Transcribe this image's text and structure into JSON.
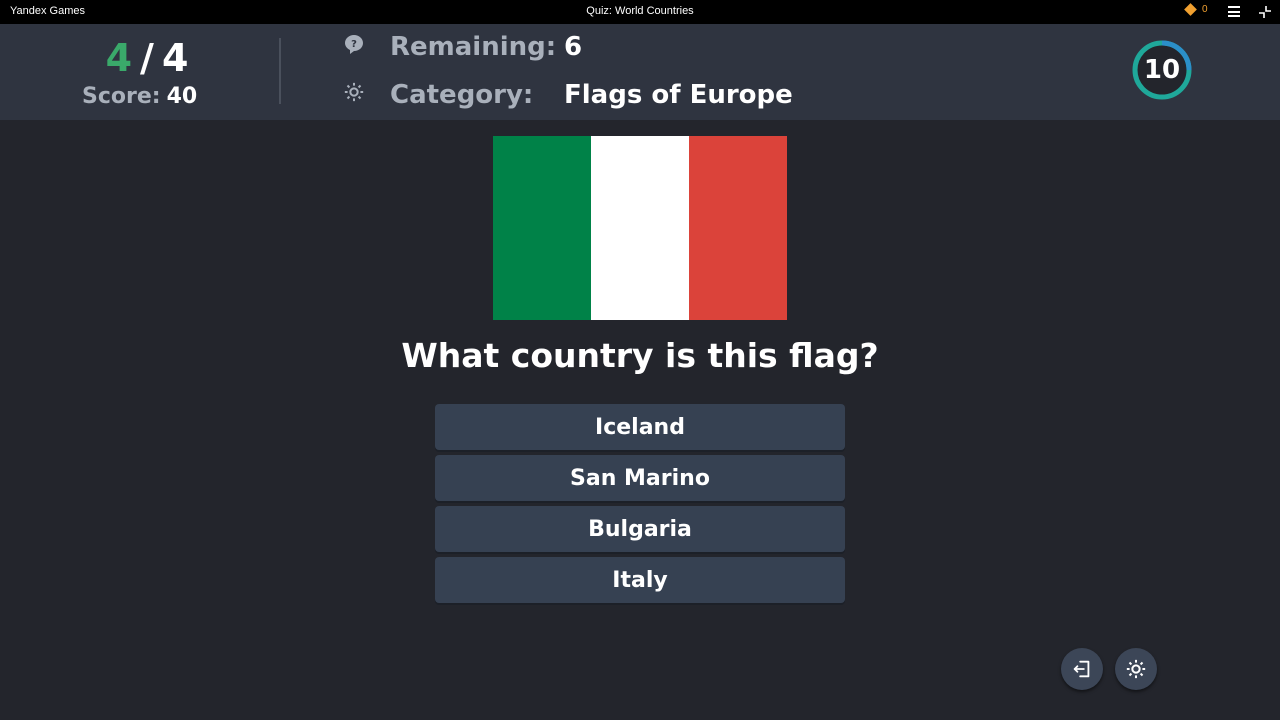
{
  "topbar": {
    "app_title": "Yandex Games",
    "game_title": "Quiz: World Countries",
    "coins": "0",
    "coin_color": "#f0a030"
  },
  "header": {
    "answered": "4",
    "separator": "/",
    "total": "4",
    "score_label": "Score:",
    "score_value": "40",
    "remaining_label": "Remaining:",
    "remaining_value": "6",
    "category_label": "Category:",
    "category_value": "Flags of Europe",
    "timer": "10",
    "remaining_icon": "question-bubble-icon",
    "category_icon": "gear-icon"
  },
  "flag": {
    "colors": [
      "#008248",
      "#ffffff",
      "#db433a"
    ]
  },
  "question": "What country is this flag?",
  "answers": [
    {
      "label": "Iceland"
    },
    {
      "label": "San Marino"
    },
    {
      "label": "Bulgaria"
    },
    {
      "label": "Italy"
    }
  ],
  "buttons": {
    "exit_icon": "exit-icon",
    "settings_icon": "gear-icon"
  },
  "colors": {
    "background": "#23252c",
    "header": "#2f3440",
    "answer_button": "#364152",
    "accent_green": "#3aa96a",
    "timer_ring": "#1fa89a"
  }
}
